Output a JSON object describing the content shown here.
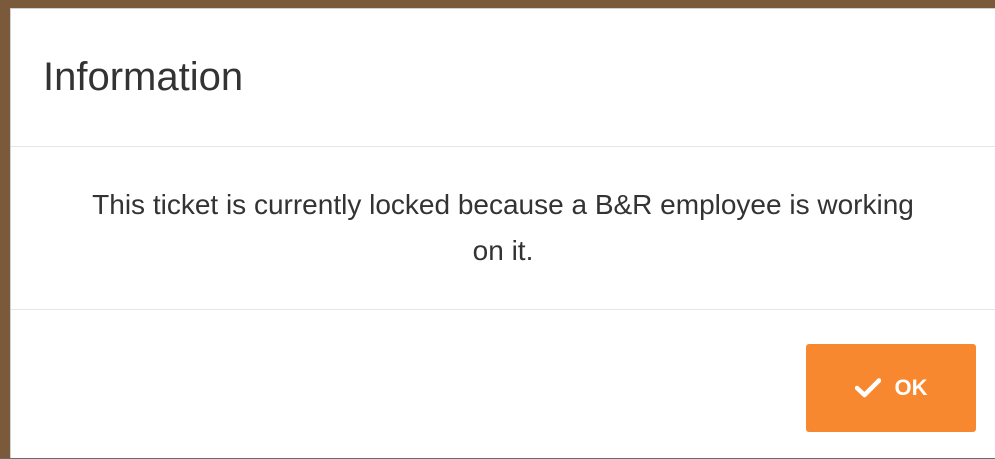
{
  "dialog": {
    "title": "Information",
    "message": "This ticket is currently locked because a B&R employee is working on it.",
    "ok_label": "OK",
    "ok_icon": "check-icon"
  },
  "colors": {
    "accent": "#f7882f",
    "text": "#333333",
    "divider": "#e5e5e5"
  }
}
